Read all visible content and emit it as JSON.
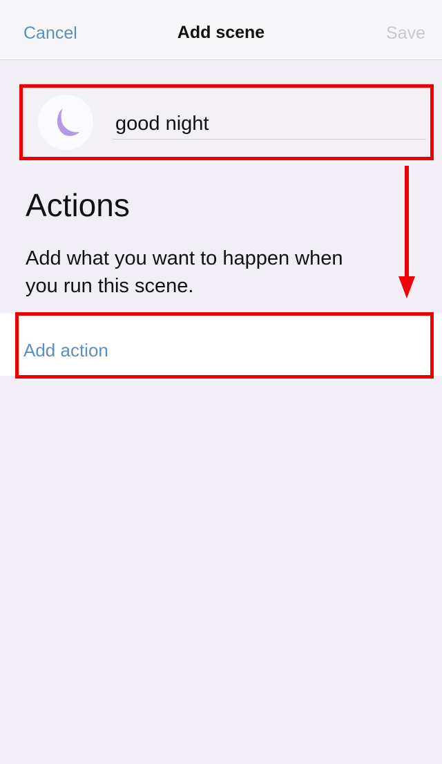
{
  "nav": {
    "cancel_label": "Cancel",
    "title": "Add scene",
    "save_label": "Save"
  },
  "scene": {
    "icon": "moon-icon",
    "name_value": "good night"
  },
  "actions": {
    "title": "Actions",
    "description_line1": "Add what you want to happen when",
    "description_line2": "you run this scene.",
    "add_action_label": "Add action"
  },
  "colors": {
    "accent": "#5a8fc1",
    "highlight": "#ee0000",
    "background": "#f1eef5",
    "moon": "#b39ae6",
    "disabled": "#c8c8cc"
  }
}
